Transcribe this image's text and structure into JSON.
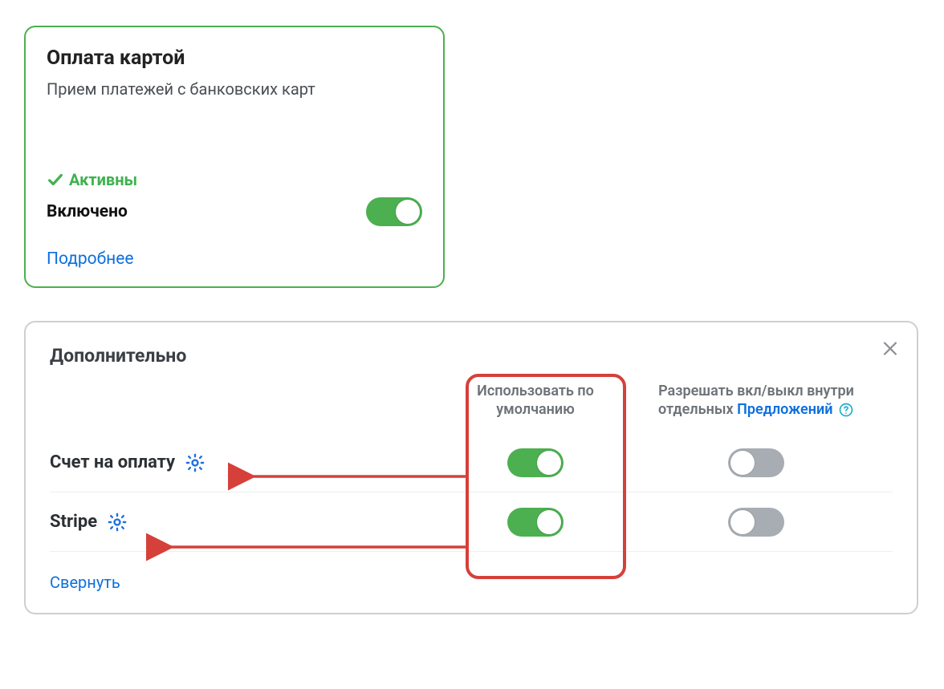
{
  "card": {
    "title": "Оплата картой",
    "desc": "Прием платежей с банковских карт",
    "status": "Активны",
    "enabled_label": "Включено",
    "enabled": true,
    "more": "Подробнее"
  },
  "panel": {
    "title": "Дополнительно",
    "header_default": "Использовать по умолчанию",
    "header_allow_prefix": "Разрешать вкл/выкл внутри отдельных ",
    "header_allow_link": "Предложений",
    "collapse": "Свернуть",
    "rows": [
      {
        "name": "Счет на оплату",
        "default_on": true,
        "allow_on": false
      },
      {
        "name": "Stripe",
        "default_on": true,
        "allow_on": false
      }
    ]
  },
  "colors": {
    "green": "#4caf50",
    "blue": "#0d6fde",
    "red": "#d6403a",
    "grey_toggle": "#a8adb3"
  }
}
